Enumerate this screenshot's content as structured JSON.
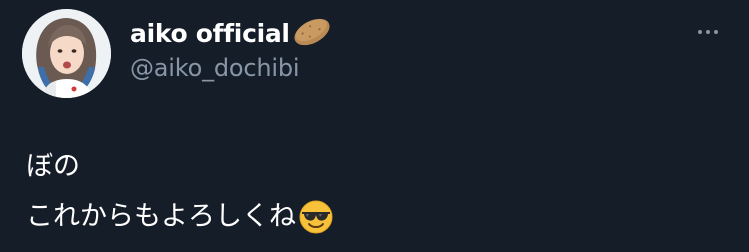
{
  "profile": {
    "display_name": "aiko official",
    "name_emoji": "potato-icon",
    "handle": "@aiko_dochibi"
  },
  "tweet": {
    "lines": [
      "ぼの",
      "これからもよろしくね"
    ],
    "trailing_emoji": "smiling-face-with-sunglasses-icon"
  },
  "colors": {
    "background": "#151d29",
    "primary_text": "#ffffff",
    "secondary_text": "#8796a6"
  }
}
